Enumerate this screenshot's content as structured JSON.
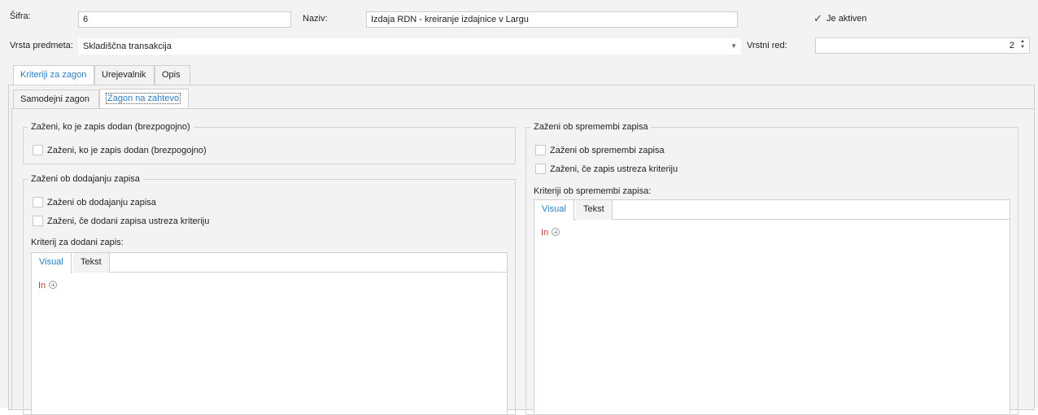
{
  "form": {
    "sifra_label": "Šifra:",
    "sifra_value": "6",
    "naziv_label": "Naziv:",
    "naziv_value": "Izdaja RDN - kreiranje izdajnice v Largu",
    "aktiven_label": "Je aktiven",
    "aktiven_checked": true,
    "vrsta_label": "Vrsta predmeta:",
    "vrsta_value": "Skladiščna transakcija",
    "vrstni_red_label": "Vrstni red:",
    "vrstni_red_value": "2"
  },
  "main_tabs": [
    {
      "label": "Kriteriji za zagon",
      "active": true
    },
    {
      "label": "Urejevalnik",
      "active": false
    },
    {
      "label": "Opis",
      "active": false
    }
  ],
  "sub_tabs": [
    {
      "label": "Samodejni zagon",
      "active": false
    },
    {
      "label": "Zagon na zahtevo",
      "active": true
    }
  ],
  "group_added_unconditional": {
    "title": "Zaženi, ko je zapis dodan (brezpogojno)",
    "checkbox_label": "Zaženi, ko je zapis dodan (brezpogojno)"
  },
  "group_on_add": {
    "title": "Zaženi ob dodajanju zapisa",
    "checkbox1_label": "Zaženi ob dodajanju zapisa",
    "checkbox2_label": "Zaženi, če dodani zapisa ustreza kriteriju",
    "criteria_label": "Kriterij za dodani zapis:",
    "tabs": [
      "Visual",
      "Tekst"
    ],
    "operator": "In"
  },
  "group_on_change": {
    "title": "Zaženi ob spremembi zapisa",
    "checkbox1_label": "Zaženi ob spremembi zapisa",
    "checkbox2_label": "Zaženi, če zapis ustreza kriteriju",
    "criteria_label": "Kriteriji ob spremembi zapisa:",
    "tabs": [
      "Visual",
      "Tekst"
    ],
    "operator": "In"
  }
}
